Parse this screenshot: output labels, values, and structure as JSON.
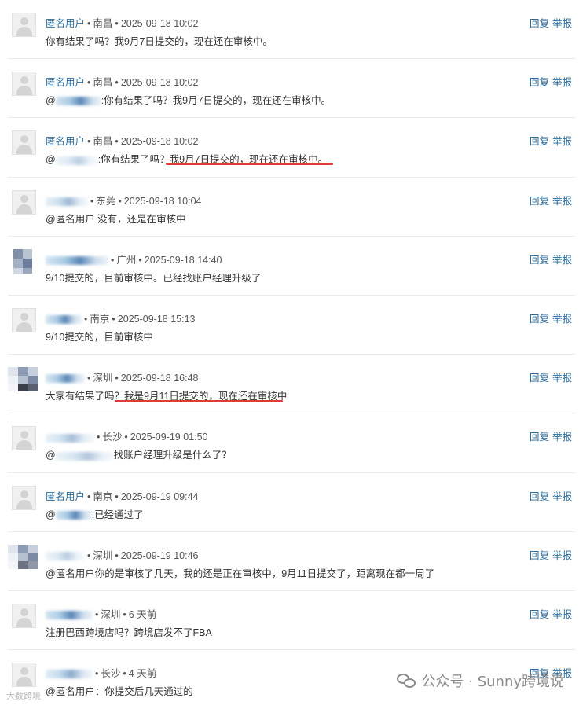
{
  "comments": [
    {
      "user": "匿名用户",
      "user_visible": true,
      "location": "南昌",
      "time": "2025-09-18 10:02",
      "mention": "",
      "text": "你有结果了吗？我9月7日提交的，现在还在审核中。"
    },
    {
      "user": "匿名用户",
      "user_visible": true,
      "location": "南昌",
      "time": "2025-09-18 10:02",
      "mention": "@",
      "text": ":你有结果了吗？我9月7日提交的，现在还在审核中。"
    },
    {
      "user": "匿名用户",
      "user_visible": true,
      "location": "南昌",
      "time": "2025-09-18 10:02",
      "mention": "@",
      "text": ":你有结果了吗？我9月7日提交的，现在还在审核中。"
    },
    {
      "user": "",
      "user_visible": false,
      "location": "东莞",
      "time": "2025-09-18 10:04",
      "mention": "",
      "text": "@匿名用户 没有，还是在审核中"
    },
    {
      "user": "",
      "user_visible": false,
      "location": "广州",
      "time": "2025-09-18 14:40",
      "mention": "",
      "text": "9/10提交的，目前审核中。已经找账户经理升级了"
    },
    {
      "user": "",
      "user_visible": false,
      "location": "南京",
      "time": "2025-09-18 15:13",
      "mention": "",
      "text": "9/10提交的，目前审核中"
    },
    {
      "user": "",
      "user_visible": false,
      "location": "深圳",
      "time": "2025-09-18 16:48",
      "mention": "",
      "text": "大家有结果了吗？我是9月11日提交的，现在还在审核中"
    },
    {
      "user": "",
      "user_visible": false,
      "location": "长沙",
      "time": "2025-09-19 01:50",
      "mention": "@",
      "text": "找账户经理升级是什么了？"
    },
    {
      "user": "匿名用户",
      "user_visible": true,
      "location": "南京",
      "time": "2025-09-19 09:44",
      "mention": "@",
      "text": ":已经通过了"
    },
    {
      "user": "",
      "user_visible": false,
      "location": "深圳",
      "time": "2025-09-19 10:46",
      "mention": "",
      "text": "@匿名用户你的是审核了几天，我的还是正在审核中，9月11日提交了，距离现在都一周了"
    },
    {
      "user": "",
      "user_visible": false,
      "location": "深圳",
      "time": "6 天前",
      "mention": "",
      "text": "注册巴西跨境店吗？跨境店发不了FBA"
    },
    {
      "user": "",
      "user_visible": false,
      "location": "长沙",
      "time": "4 天前",
      "mention": "",
      "text": "@匿名用户：你提交后几天通过的"
    }
  ],
  "actions": {
    "reply": "回复",
    "report": "举报"
  },
  "separator": "•",
  "watermark": {
    "text": "公众号 · Sunny跨境说"
  },
  "corner_mark": "大数跨境",
  "colors": {
    "link": "#2c6e9b",
    "underline": "#e03a3a",
    "text": "#333333"
  }
}
